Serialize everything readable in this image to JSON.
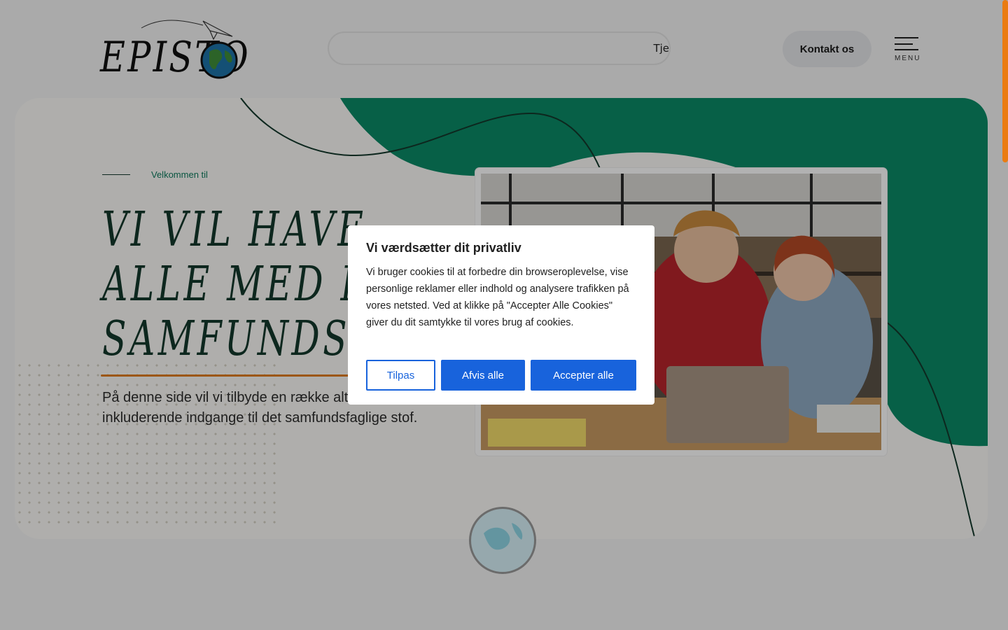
{
  "header": {
    "logo_text": "EPISTO",
    "search_text": "Tje",
    "contact_label": "Kontakt os",
    "menu_label": "MENU"
  },
  "hero": {
    "welcome": "Velkommen til",
    "title_lines": [
      "VI VIL HAVE",
      "ALLE MED I",
      "SAMFUNDSFAG"
    ],
    "body": "På denne side vil vi tilbyde en række alternative og inkluderende indgange til det samfundsfaglige stof."
  },
  "cookie": {
    "title": "Vi værdsætter dit privatliv",
    "text": "Vi bruger cookies til at forbedre din browseroplevelse, vise personlige reklamer eller indhold og analysere trafikken på vores netsted. Ved at klikke på \"Accepter Alle Cookies\" giver du dit samtykke til vores brug af cookies.",
    "customize_label": "Tilpas",
    "reject_label": "Afvis alle",
    "accept_label": "Accepter alle"
  },
  "colors": {
    "accent_green": "#0b8a66",
    "accent_orange": "#e07b19",
    "button_blue": "#1863dc"
  }
}
